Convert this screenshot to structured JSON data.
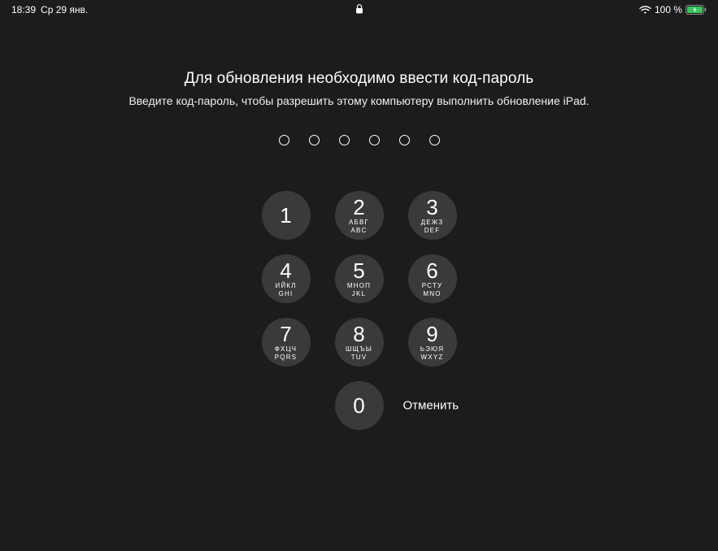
{
  "statusBar": {
    "time": "18:39",
    "date": "Ср 29 янв.",
    "batteryText": "100 %"
  },
  "title": "Для обновления необходимо ввести код-пароль",
  "subtitle": "Введите код-пароль, чтобы разрешить этому компьютеру выполнить обновление iPad.",
  "passcodeLength": 6,
  "keypad": {
    "1": {
      "digit": "1",
      "letters1": "",
      "letters2": ""
    },
    "2": {
      "digit": "2",
      "letters1": "АБВГ",
      "letters2": "ABC"
    },
    "3": {
      "digit": "3",
      "letters1": "ДЕЖЗ",
      "letters2": "DEF"
    },
    "4": {
      "digit": "4",
      "letters1": "ИЙКЛ",
      "letters2": "GHI"
    },
    "5": {
      "digit": "5",
      "letters1": "МНОП",
      "letters2": "JKL"
    },
    "6": {
      "digit": "6",
      "letters1": "РСТУ",
      "letters2": "MNO"
    },
    "7": {
      "digit": "7",
      "letters1": "ФХЦЧ",
      "letters2": "PQRS"
    },
    "8": {
      "digit": "8",
      "letters1": "ШЩЪЫ",
      "letters2": "TUV"
    },
    "9": {
      "digit": "9",
      "letters1": "ЬЭЮЯ",
      "letters2": "WXYZ"
    },
    "0": {
      "digit": "0",
      "letters1": "",
      "letters2": ""
    }
  },
  "cancelLabel": "Отменить"
}
